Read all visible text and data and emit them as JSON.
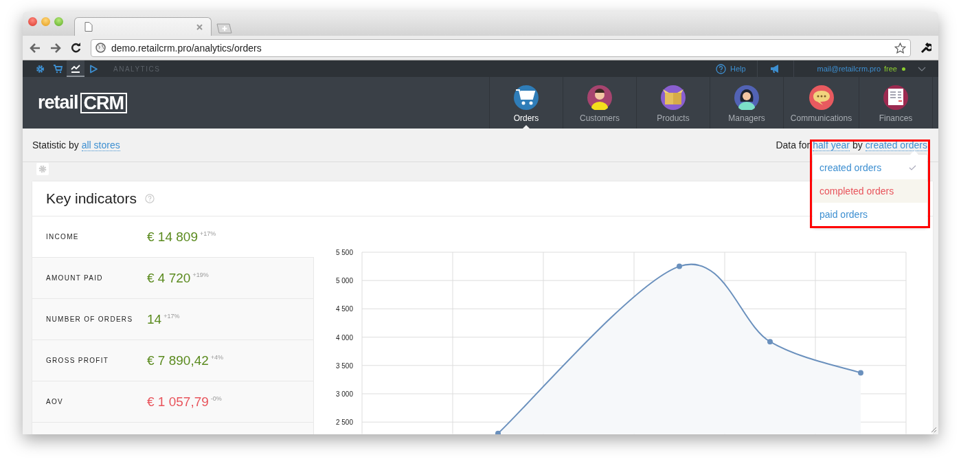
{
  "browser": {
    "url": "demo.retailcrm.pro/analytics/orders"
  },
  "top_bar": {
    "apps": [
      {
        "kind": "gear",
        "selected": false
      },
      {
        "kind": "cart",
        "selected": false
      },
      {
        "kind": "chart",
        "selected": true
      },
      {
        "kind": "play",
        "selected": false
      }
    ],
    "section": "ANALYTICS",
    "help": "Help",
    "email": "mail@retailcrm.pro",
    "plan": "free"
  },
  "header": {
    "logo": {
      "word": "retail",
      "mark": "CRM"
    },
    "nav": [
      {
        "label": "Orders",
        "kind": "cart",
        "selected": true
      },
      {
        "label": "Customers",
        "kind": "person",
        "selected": false
      },
      {
        "label": "Products",
        "kind": "box",
        "selected": false
      },
      {
        "label": "Managers",
        "kind": "person2",
        "selected": false
      },
      {
        "label": "Communications",
        "kind": "chat",
        "selected": false
      },
      {
        "label": "Finances",
        "kind": "doc",
        "selected": false
      }
    ]
  },
  "filters": {
    "prefix": "Statistic by",
    "stores": "all stores",
    "data_for": "Data for",
    "period": "half year",
    "by": "by",
    "mode": "created orders"
  },
  "dropdown": {
    "items": [
      {
        "label": "created orders",
        "selected": true,
        "highlighted": false
      },
      {
        "label": "completed orders",
        "selected": false,
        "highlighted": true
      },
      {
        "label": "paid orders",
        "selected": false,
        "highlighted": false
      }
    ]
  },
  "indicators": {
    "title": "Key indicators",
    "rows": [
      {
        "label": "INCOME",
        "value": "€ 14 809",
        "change": "+17%",
        "color": "#5a8a1e"
      },
      {
        "label": "AMOUNT PAID",
        "value": "€ 4 720",
        "change": "+19%",
        "color": "#5a8a1e"
      },
      {
        "label": "NUMBER OF ORDERS",
        "value": "14",
        "change": "+17%",
        "color": "#5a8a1e"
      },
      {
        "label": "GROSS PROFIT",
        "value": "€ 7 890,42",
        "change": "+4%",
        "color": "#5a8a1e"
      },
      {
        "label": "AOV",
        "value": "€ 1 057,79",
        "change": "-0%",
        "color": "#e8535b"
      }
    ],
    "chart_data": {
      "type": "area",
      "categories": [
        null,
        null,
        null,
        null,
        null,
        null
      ],
      "ylim": [
        2290,
        5500
      ],
      "grid": true,
      "yticks": [
        {
          "value": 2500,
          "label": "2 500"
        },
        {
          "value": 3000,
          "label": "3 000"
        },
        {
          "value": 3500,
          "label": "3 500"
        },
        {
          "value": 4000,
          "label": "4 000"
        },
        {
          "value": 4500,
          "label": "4 500"
        },
        {
          "value": 5000,
          "label": "5 000"
        },
        {
          "value": 5500,
          "label": "5 500"
        }
      ],
      "series": [
        {
          "color": "#6a90bd",
          "values": [
            null,
            2300,
            null,
            5250,
            3920,
            3370
          ]
        }
      ]
    }
  }
}
